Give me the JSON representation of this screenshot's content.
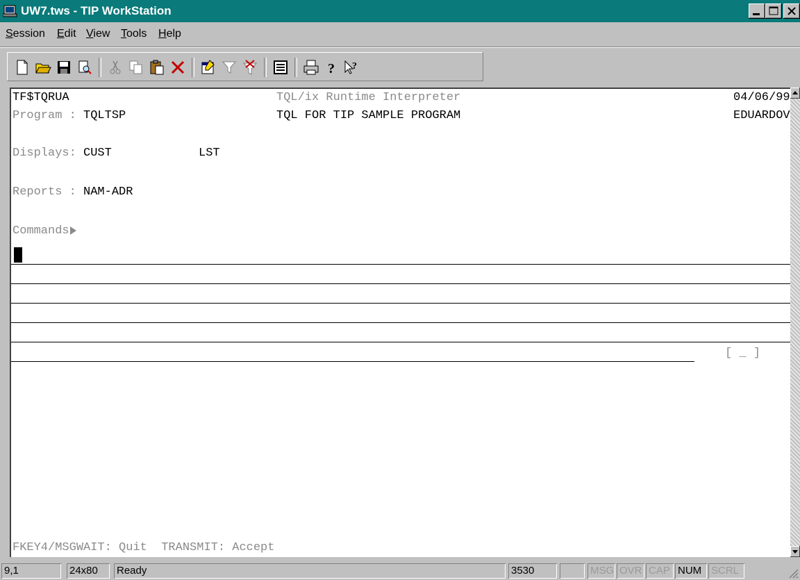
{
  "window": {
    "title": "UW7.tws - TIP WorkStation",
    "app_icon": "terminal-app-icon",
    "controls": [
      "minimize-icon",
      "maximize-icon",
      "close-icon"
    ]
  },
  "menu": {
    "items": [
      {
        "label": "Session",
        "accel": "S"
      },
      {
        "label": "Edit",
        "accel": "E"
      },
      {
        "label": "View",
        "accel": "V"
      },
      {
        "label": "Tools",
        "accel": "T"
      },
      {
        "label": "Help",
        "accel": "H"
      }
    ]
  },
  "toolbar": {
    "icons": [
      "new-icon",
      "open-icon",
      "save-icon",
      "print-preview-icon",
      "cut-icon",
      "copy-icon",
      "paste-icon",
      "delete-icon",
      "properties-icon",
      "filter-icon",
      "filter-remove-icon",
      "screen-icon",
      "print-icon",
      "help-icon",
      "context-help-icon"
    ]
  },
  "terminal": {
    "row1": {
      "left": "TF$TQRUA",
      "center": "TQL/ix Runtime Interpreter",
      "right": "04/06/99"
    },
    "row2": {
      "label": "Program : ",
      "value": "TQLTSP",
      "center": "TQL FOR TIP SAMPLE PROGRAM",
      "right": "EDUARDOV"
    },
    "displays": {
      "label": "Displays: ",
      "value1": "CUST",
      "value2": "LST"
    },
    "reports": {
      "label": "Reports : ",
      "value": "NAM-ADR"
    },
    "commands_label": "Commands",
    "bracket": "[ _ ]",
    "footer": "FKEY4/MSGWAIT: Quit  TRANSMIT: Accept"
  },
  "status": {
    "position": "9,1",
    "size": "24x80",
    "state": "Ready",
    "code": "3530",
    "blank": "",
    "indicators": [
      {
        "label": "MSG",
        "active": false
      },
      {
        "label": "OVR",
        "active": false
      },
      {
        "label": "CAP",
        "active": false
      },
      {
        "label": "NUM",
        "active": true
      },
      {
        "label": "SCRL",
        "active": false
      }
    ]
  }
}
